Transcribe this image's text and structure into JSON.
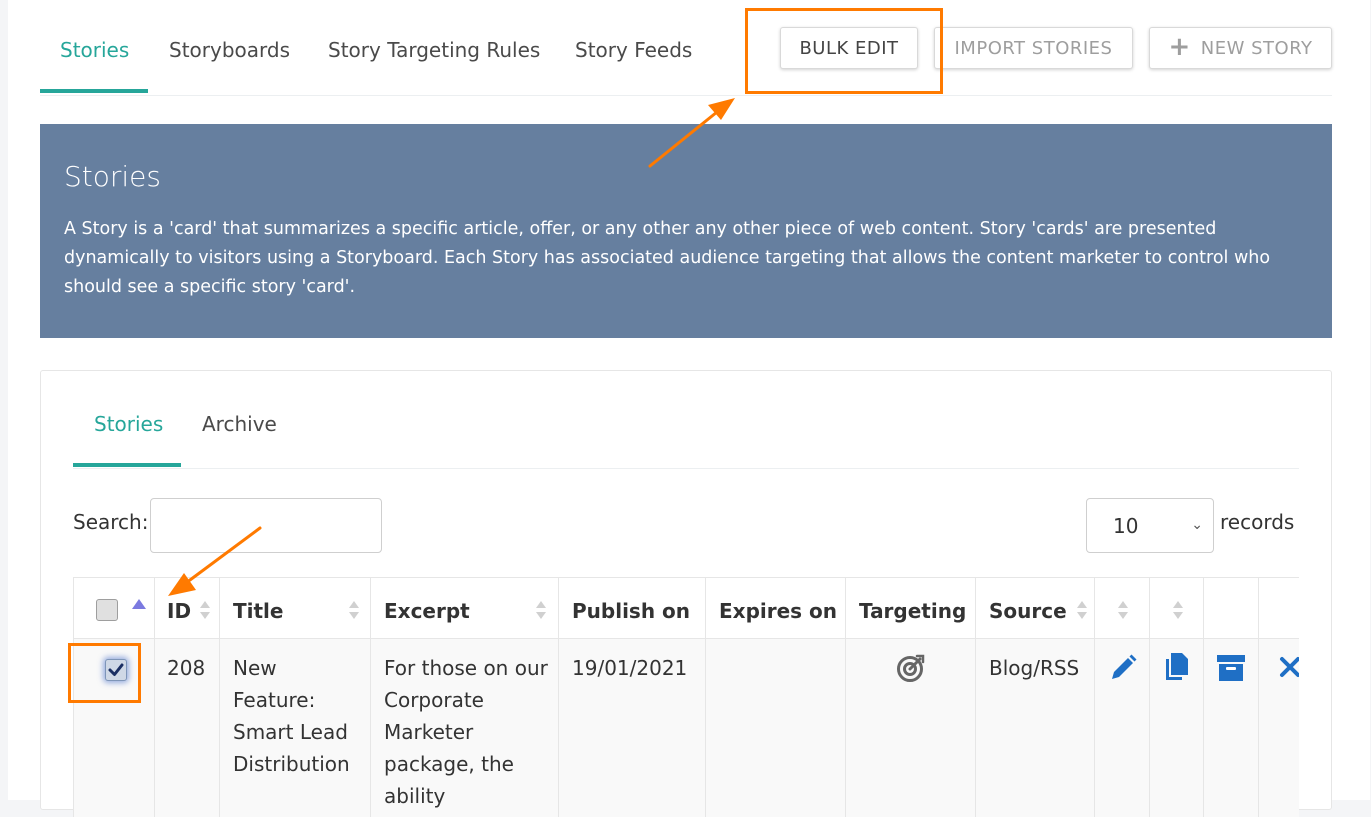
{
  "top_tabs": [
    {
      "label": "Stories",
      "active": true
    },
    {
      "label": "Storyboards",
      "active": false
    },
    {
      "label": "Story Targeting Rules",
      "active": false
    },
    {
      "label": "Story Feeds",
      "active": false
    }
  ],
  "toolbar": {
    "bulk_edit_label": "BULK EDIT",
    "import_label": "IMPORT STORIES",
    "new_story_label": "NEW STORY"
  },
  "banner": {
    "title": "Stories",
    "description": "A Story is a 'card' that summarizes a specific article, offer, or any other any other piece of web content. Story 'cards' are presented dynamically to visitors using a Storyboard. Each Story has associated audience targeting that allows the content marketer to control who should see a specific story 'card'."
  },
  "inner_tabs": [
    {
      "label": "Stories",
      "active": true
    },
    {
      "label": "Archive",
      "active": false
    }
  ],
  "search": {
    "label": "Search:",
    "value": "",
    "placeholder": ""
  },
  "records": {
    "selected": "10",
    "label": "records"
  },
  "table": {
    "columns": [
      "",
      "ID",
      "Title",
      "Excerpt",
      "Publish on",
      "Expires on",
      "Targeting",
      "Source",
      "",
      "",
      "",
      ""
    ],
    "rows": [
      {
        "checked": true,
        "id": "208",
        "title": "New Feature: Smart Lead Distribution",
        "excerpt": "For those on our Corporate Marketer package, the ability",
        "publish_on": "19/01/2021",
        "expires_on": "",
        "targeting_icon": "target-icon",
        "source": "Blog/RSS",
        "actions": [
          "edit-icon",
          "copy-icon",
          "archive-icon",
          "delete-icon"
        ]
      }
    ]
  },
  "colors": {
    "accent": "#26a69a",
    "banner": "#667f9f",
    "highlight": "#ff7a00",
    "action_icon": "#1f6fc5"
  }
}
